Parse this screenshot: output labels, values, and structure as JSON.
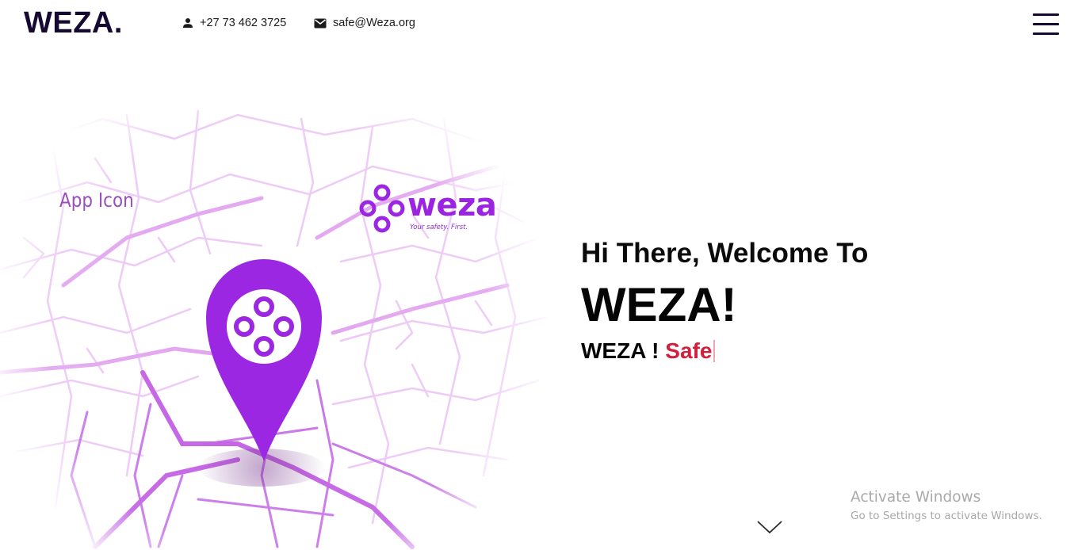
{
  "header": {
    "brand": "WEZA.",
    "phone_icon": "person-icon",
    "phone": "+27 73 462 3725",
    "email_icon": "mail-icon",
    "email": "safe@Weza.org",
    "menu_icon": "hamburger-menu-icon"
  },
  "hero_image": {
    "label": "App Icon",
    "logo_word": "weza",
    "logo_tagline": "Your safety. First.",
    "accent_color": "#9b27e3"
  },
  "hero": {
    "greeting": "Hi There, Welcome To",
    "title": "WEZA!",
    "tagline_prefix": "WEZA ! ",
    "tagline_word": "Safe",
    "highlight_color": "#d21f3c"
  },
  "scroll_icon": "chevron-down-icon",
  "watermark": {
    "title": "Activate Windows",
    "subtitle": "Go to Settings to activate Windows."
  }
}
